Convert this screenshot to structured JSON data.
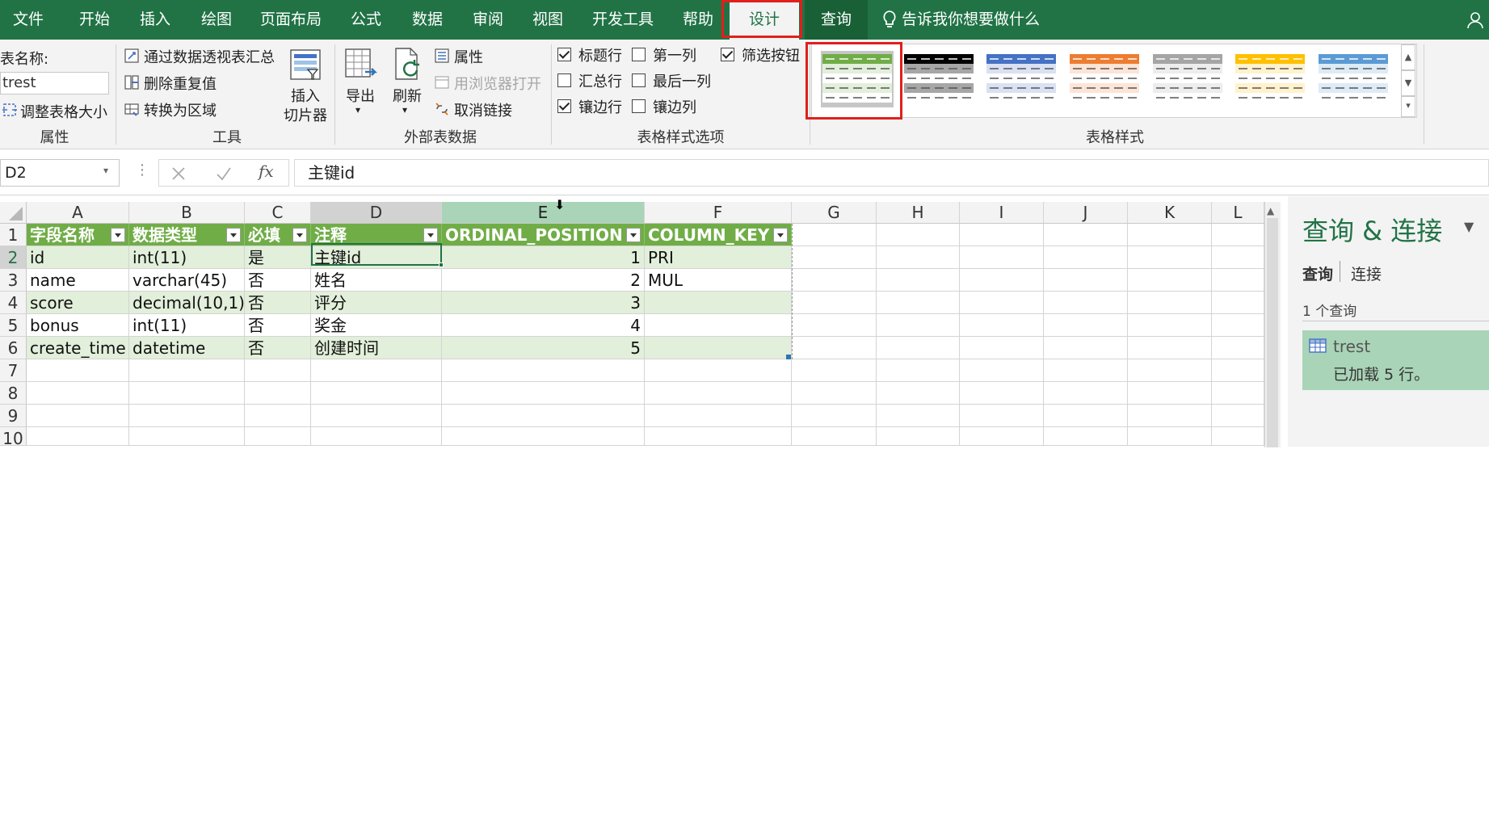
{
  "tabs": [
    {
      "label": "文件"
    },
    {
      "label": "开始"
    },
    {
      "label": "插入"
    },
    {
      "label": "绘图"
    },
    {
      "label": "页面布局"
    },
    {
      "label": "公式"
    },
    {
      "label": "数据"
    },
    {
      "label": "审阅"
    },
    {
      "label": "视图"
    },
    {
      "label": "开发工具"
    },
    {
      "label": "帮助"
    },
    {
      "label": "设计"
    },
    {
      "label": "查询"
    }
  ],
  "tell_me": "告诉我你想要做什么",
  "ribbon": {
    "properties": {
      "table_name_label": "表名称:",
      "table_name_value": "trest",
      "resize_label": "调整表格大小",
      "group_label": "属性"
    },
    "tools": {
      "pivot_label": "通过数据透视表汇总",
      "remove_dup_label": "删除重复值",
      "convert_label": "转换为区域",
      "slicer_label_1": "插入",
      "slicer_label_2": "切片器",
      "group_label": "工具"
    },
    "external": {
      "export_label": "导出",
      "refresh_label": "刷新",
      "properties_label": "属性",
      "browser_label": "用浏览器打开",
      "unlink_label": "取消链接",
      "group_label": "外部表数据"
    },
    "style_options": {
      "header_row": {
        "label": "标题行",
        "checked": true
      },
      "total_row": {
        "label": "汇总行",
        "checked": false
      },
      "banded_rows": {
        "label": "镶边行",
        "checked": true
      },
      "first_col": {
        "label": "第一列",
        "checked": false
      },
      "last_col": {
        "label": "最后一列",
        "checked": false
      },
      "banded_cols": {
        "label": "镶边列",
        "checked": false
      },
      "filter_button": {
        "label": "筛选按钮",
        "checked": true
      },
      "group_label": "表格样式选项"
    },
    "table_styles": {
      "group_label": "表格样式",
      "styles": [
        {
          "name": "green",
          "header": "#70ad47",
          "band": "#e2efda",
          "selected": true
        },
        {
          "name": "black",
          "header": "#000000",
          "band": "#a6a6a6",
          "selected": false
        },
        {
          "name": "blue",
          "header": "#4472c4",
          "band": "#d9e1f2",
          "selected": false
        },
        {
          "name": "orange",
          "header": "#ed7d31",
          "band": "#fce4d6",
          "selected": false
        },
        {
          "name": "gray",
          "header": "#a5a5a5",
          "band": "#ededed",
          "selected": false
        },
        {
          "name": "gold",
          "header": "#ffc000",
          "band": "#fff2cc",
          "selected": false
        },
        {
          "name": "lightblue",
          "header": "#5b9bd5",
          "band": "#ddebf7",
          "selected": false
        }
      ]
    }
  },
  "formula_bar": {
    "name_box": "D2",
    "fx": "fx",
    "content": "主键id"
  },
  "grid": {
    "columns": [
      "A",
      "B",
      "C",
      "D",
      "E",
      "F",
      "G",
      "H",
      "I",
      "J",
      "K",
      "L"
    ],
    "rows": [
      "1",
      "2",
      "3",
      "4",
      "5",
      "6",
      "7",
      "8",
      "9",
      "10"
    ],
    "header": [
      "字段名称",
      "数据类型",
      "必填",
      "注释",
      "ORDINAL_POSITION",
      "COLUMN_KEY"
    ],
    "data": [
      [
        "id",
        "int(11)",
        "是",
        "主键id",
        "1",
        "PRI"
      ],
      [
        "name",
        "varchar(45)",
        "否",
        "姓名",
        "2",
        "MUL"
      ],
      [
        "score",
        "decimal(10,1)",
        "否",
        "评分",
        "3",
        ""
      ],
      [
        "bonus",
        "int(11)",
        "否",
        "奖金",
        "4",
        ""
      ],
      [
        "create_time",
        "datetime",
        "否",
        "创建时间",
        "5",
        ""
      ]
    ]
  },
  "query_pane": {
    "title": "查询 & 连接",
    "tab_queries": "查询",
    "tab_connections": "连接",
    "count": "1 个查询",
    "item_name": "trest",
    "item_status": "已加载 5 行。"
  },
  "colors": {
    "accent": "#217346",
    "table_header": "#70ad47",
    "table_band": "#e2efda",
    "highlight": "#e0201b"
  }
}
